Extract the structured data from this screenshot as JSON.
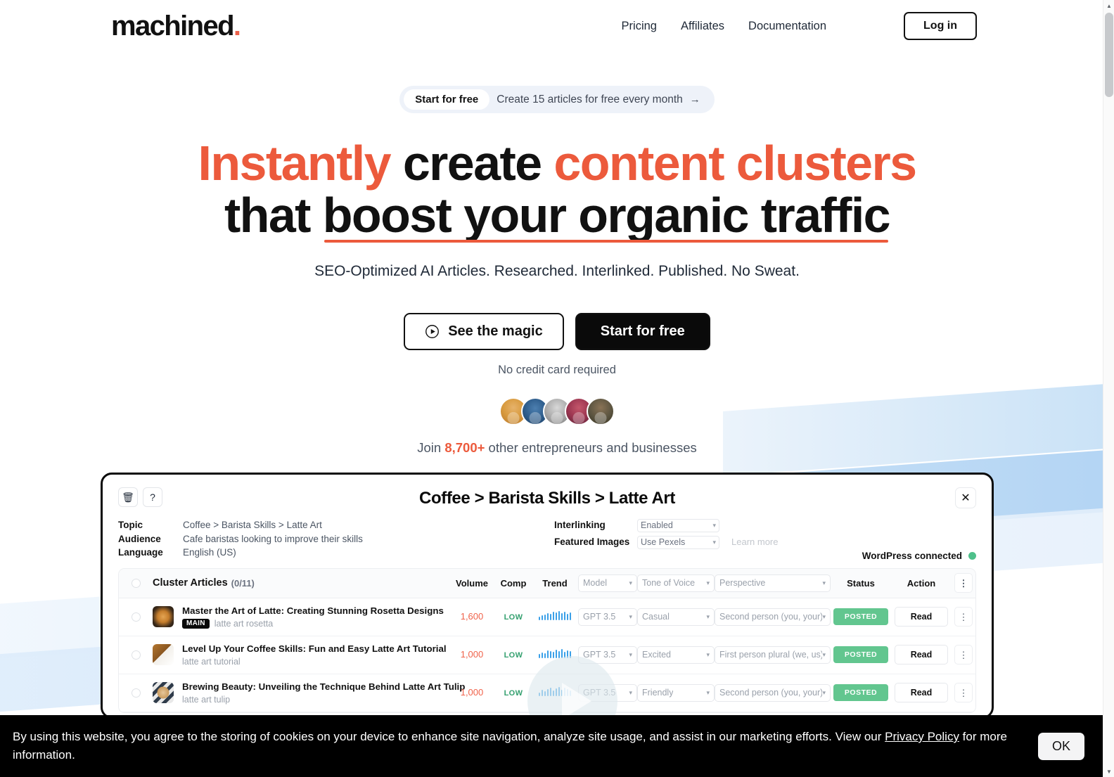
{
  "header": {
    "logo_text": "machined",
    "logo_dot": ".",
    "nav": [
      {
        "label": "Pricing"
      },
      {
        "label": "Affiliates"
      },
      {
        "label": "Documentation"
      }
    ],
    "login_label": "Log in"
  },
  "hero": {
    "promo": {
      "badge": "Start for free",
      "text": "Create 15 articles for free every month",
      "arrow": "→"
    },
    "headline": {
      "line1_part1": "Instantly",
      "line1_part2": "create",
      "line1_part3": "content clusters",
      "line2_part1": "that",
      "line2_part2": "boost your organic traffic"
    },
    "subtitle": "SEO-Optimized AI Articles. Researched. Interlinked. Published. No Sweat.",
    "cta_secondary": "See the magic",
    "cta_primary": "Start for free",
    "no_credit_card": "No credit card required",
    "social_proof": {
      "prefix": "Join ",
      "count": "8,700+",
      "suffix": " other entrepreneurs and businesses"
    }
  },
  "app": {
    "title": "Coffee > Barista Skills > Latte Art",
    "delete_icon": "🗑",
    "help_icon": "?",
    "close_icon": "✕",
    "meta": [
      {
        "label": "Topic",
        "value": "Coffee > Barista Skills > Latte Art"
      },
      {
        "label": "Audience",
        "value": "Cafe baristas looking to improve their skills"
      },
      {
        "label": "Language",
        "value": "English (US)"
      }
    ],
    "options": [
      {
        "label": "Interlinking",
        "value": "Enabled"
      },
      {
        "label": "Featured Images",
        "value": "Use Pexels"
      }
    ],
    "learn_more": "Learn more",
    "wordpress_status": "WordPress connected",
    "table": {
      "title": "Cluster Articles",
      "count": "(0/11)",
      "headers": {
        "volume": "Volume",
        "comp": "Comp",
        "trend": "Trend",
        "model": "Model",
        "tone": "Tone of Voice",
        "perspective": "Perspective",
        "status": "Status",
        "action": "Action"
      },
      "rows": [
        {
          "title": "Master the Art of Latte: Creating Stunning Rosetta Designs",
          "badge": "MAIN",
          "keyword": "latte art rosetta",
          "volume": "1,600",
          "comp": "LOW",
          "model": "GPT 3.5",
          "tone": "Casual",
          "perspective": "Second person (you, your)",
          "status": "POSTED",
          "action": "Read"
        },
        {
          "title": "Level Up Your Coffee Skills: Fun and Easy Latte Art Tutorial",
          "badge": "",
          "keyword": "latte art tutorial",
          "volume": "1,000",
          "comp": "LOW",
          "model": "GPT 3.5",
          "tone": "Excited",
          "perspective": "First person plural (we, us)",
          "status": "POSTED",
          "action": "Read"
        },
        {
          "title": "Brewing Beauty: Unveiling the Technique Behind Latte Art Tulip",
          "badge": "",
          "keyword": "latte art tulip",
          "volume": "1,000",
          "comp": "LOW",
          "model": "GPT 3.5",
          "tone": "Friendly",
          "perspective": "Second person (you, your)",
          "status": "POSTED",
          "action": "Read"
        }
      ]
    }
  },
  "cookie": {
    "text_before": "By using this website, you agree to the storing of cookies on your device to enhance site navigation, analyze site usage, and assist in our marketing efforts. View our ",
    "link": "Privacy Policy",
    "text_after": " for more information.",
    "ok_label": "OK"
  },
  "colors": {
    "accent": "#ec5a3c",
    "black": "#0a0a0a",
    "green": "#62c68f",
    "blue": "#3aa0e8"
  }
}
